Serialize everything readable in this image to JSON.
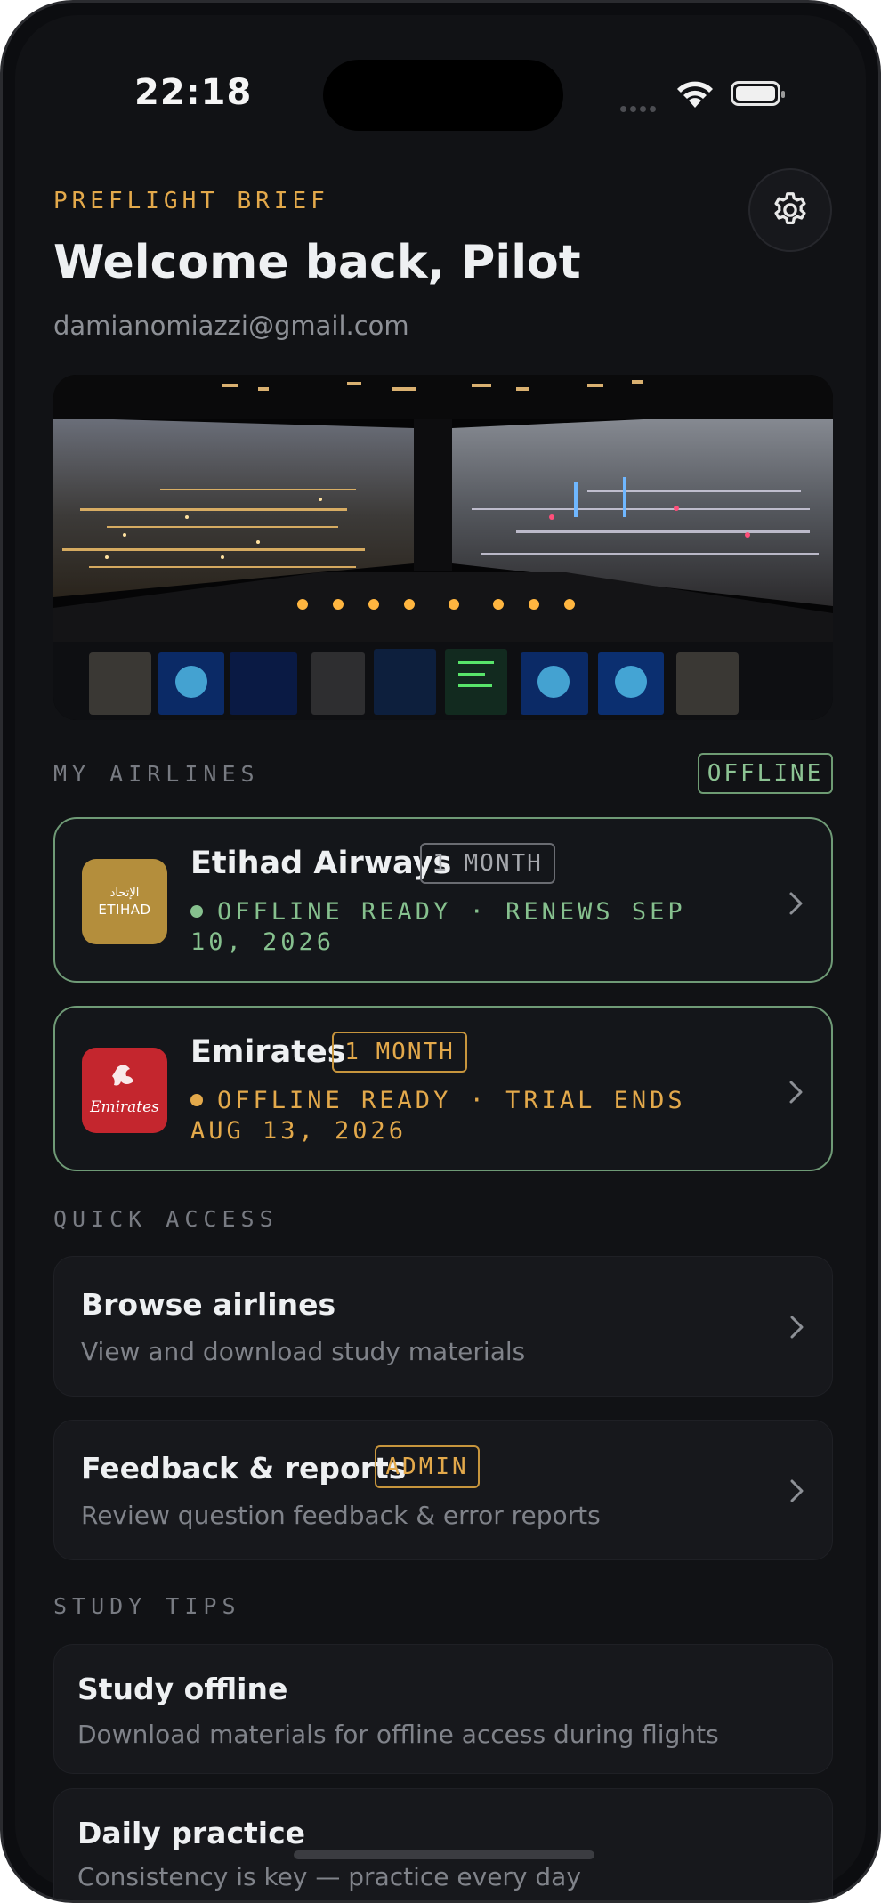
{
  "status_bar": {
    "time": "22:18"
  },
  "header": {
    "eyebrow": "PREFLIGHT BRIEF",
    "title": "Welcome back, Pilot",
    "email": "damianomiazzi@gmail.com"
  },
  "icons": {
    "settings": "gear-icon",
    "wifi": "wifi-icon",
    "battery": "battery-icon",
    "chevron": "chevron-right-icon"
  },
  "my_airlines": {
    "label": "MY AIRLINES",
    "badge": "OFFLINE",
    "items": [
      {
        "name": "Etihad Airways",
        "plan": "1 MONTH",
        "status": "OFFLINE READY · RENEWS SEP 10, 2026",
        "logo_text": "ETIHAD",
        "logo_arabic": "الإتحاد",
        "status_color": "#86c08e"
      },
      {
        "name": "Emirates",
        "plan": "1 MONTH",
        "status": "OFFLINE READY · TRIAL ENDS AUG 13, 2026",
        "logo_text": "Emirates",
        "status_color": "#e3a94b"
      }
    ]
  },
  "quick_access": {
    "label": "QUICK ACCESS",
    "items": [
      {
        "title": "Browse airlines",
        "subtitle": "View and download study materials"
      },
      {
        "title": "Feedback & reports",
        "badge": "ADMIN",
        "subtitle": "Review question feedback & error reports"
      }
    ]
  },
  "study_tips": {
    "label": "STUDY TIPS",
    "items": [
      {
        "title": "Study offline",
        "subtitle": "Download materials for offline access during flights"
      },
      {
        "title": "Daily practice",
        "subtitle": "Consistency is key — practice every day"
      }
    ]
  },
  "colors": {
    "accent_gold": "#e3a94b",
    "accent_green": "#86c08e",
    "background": "#111215"
  }
}
